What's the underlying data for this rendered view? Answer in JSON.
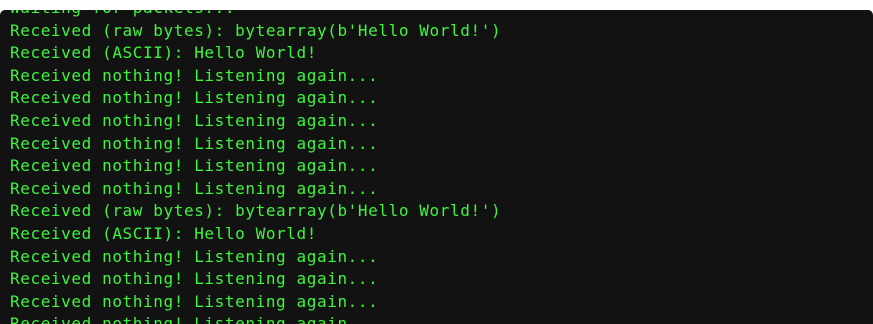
{
  "terminal": {
    "text_color": "#3ef53e",
    "background_color": "#121212",
    "lines": [
      "Waiting for packets...",
      "Received (raw bytes): bytearray(b'Hello World!')",
      "Received (ASCII): Hello World!",
      "Received nothing! Listening again...",
      "Received nothing! Listening again...",
      "Received nothing! Listening again...",
      "Received nothing! Listening again...",
      "Received nothing! Listening again...",
      "Received nothing! Listening again...",
      "Received (raw bytes): bytearray(b'Hello World!')",
      "Received (ASCII): Hello World!",
      "Received nothing! Listening again...",
      "Received nothing! Listening again...",
      "Received nothing! Listening again...",
      "Received nothing! Listening again..."
    ]
  }
}
